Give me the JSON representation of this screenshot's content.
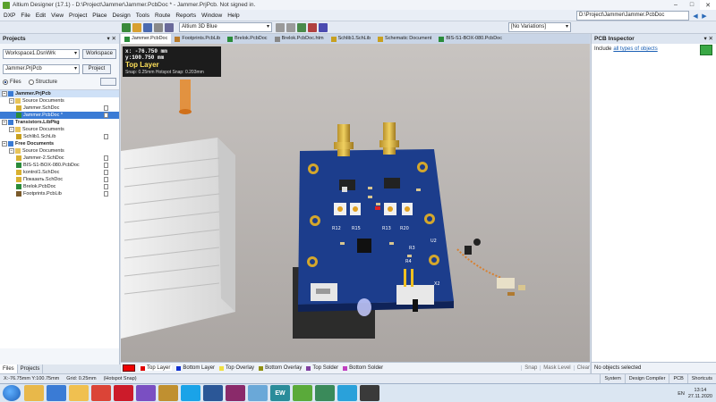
{
  "window": {
    "title": "Altium Designer (17.1) - D:\\Project\\Jammer\\Jammer.PcbDoc * - Jammer.PrjPcb. Not signed in.",
    "path": "D:\\Project\\Jammer\\Jammer.PcbDoc"
  },
  "menu": [
    "DXP",
    "File",
    "Edit",
    "View",
    "Project",
    "Place",
    "Design",
    "Tools",
    "Route",
    "Reports",
    "Window",
    "Help"
  ],
  "toolbar": {
    "view_mode": "Altium 3D Blue",
    "variations": "[No Variations]"
  },
  "projects_panel": {
    "title": "Projects",
    "workspace": "Workspace1.DsnWrk",
    "workspace_button": "Workspace",
    "project": "Jammer.PrjPcb",
    "project_button": "Project",
    "radio_files": "Files",
    "radio_structure": "Structure",
    "tree": [
      {
        "label": "Jammer.PrjPcb",
        "level": 0,
        "type": "project",
        "bold": true,
        "hl": true
      },
      {
        "label": "Source Documents",
        "level": 1,
        "type": "folder"
      },
      {
        "label": "Jammer.SchDoc",
        "level": 2,
        "type": "sch"
      },
      {
        "label": "Jammer.PcbDoc *",
        "level": 2,
        "type": "pcb",
        "selected": true
      },
      {
        "label": "Transistors.LibPkg",
        "level": 0,
        "type": "project",
        "bold": true
      },
      {
        "label": "Source Documents",
        "level": 1,
        "type": "folder"
      },
      {
        "label": "Schlib1.SchLib",
        "level": 2,
        "type": "schlib"
      },
      {
        "label": "Free Documents",
        "level": 0,
        "type": "project",
        "bold": true
      },
      {
        "label": "Source Documents",
        "level": 1,
        "type": "folder"
      },
      {
        "label": "Jammer-2.SchDoc",
        "level": 2,
        "type": "sch"
      },
      {
        "label": "BIS-S1-BOX-080.PcbDoc",
        "level": 2,
        "type": "pcb"
      },
      {
        "label": "kontrol1.SchDoc",
        "level": 2,
        "type": "sch"
      },
      {
        "label": "Показать.SchDoc",
        "level": 2,
        "type": "sch"
      },
      {
        "label": "Brelok.PcbDoc",
        "level": 2,
        "type": "pcb"
      },
      {
        "label": "Footprints.PcbLib",
        "level": 2,
        "type": "pcblib"
      }
    ],
    "footer_tabs": [
      "Files",
      "Projects"
    ]
  },
  "doc_tabs": [
    {
      "label": "Jammer.PcbDoc",
      "active": true,
      "color": "#2a8c3a"
    },
    {
      "label": "Footprints.PcbLib",
      "color": "#b87b2a"
    },
    {
      "label": "Brelok.PcbDoc",
      "color": "#2a8c3a"
    },
    {
      "label": "Brelok.PcbDoc.htm",
      "color": "#888888"
    },
    {
      "label": "Schlib1.SchLib",
      "color": "#c8a020"
    },
    {
      "label": "Schematic Document",
      "color": "#c8a020"
    },
    {
      "label": "BIS-S1-BOX-080.PcbDoc",
      "color": "#2a8c3a"
    }
  ],
  "hud": {
    "x": "x: -76.750 mm",
    "y": "y:100.750 mm",
    "layer": "Top Layer",
    "snap": "Snap: 0.25mm Hotspot Snap: 0.203mm"
  },
  "layers": [
    {
      "label": "Top Layer",
      "color": "#e00000",
      "active": true
    },
    {
      "label": "Bottom Layer",
      "color": "#1030d0"
    },
    {
      "label": "Top Overlay",
      "color": "#f0e040"
    },
    {
      "label": "Bottom Overlay",
      "color": "#909010"
    },
    {
      "label": "Top Solder",
      "color": "#8040a0"
    },
    {
      "label": "Bottom Solder",
      "color": "#c040c0"
    }
  ],
  "layer_bar_tools": [
    "Snap",
    "Mask Level",
    "Clear"
  ],
  "inspector": {
    "title": "PCB Inspector",
    "include_label": "Include",
    "include_link": "all types of objects",
    "selection": "No objects selected"
  },
  "status": {
    "coords": "X:-76.75mm Y:100.75mm",
    "grid": "Grid: 0.25mm",
    "snap": "(Hotspot Snap)",
    "right": [
      "System",
      "Design Compiler",
      "PCB",
      "Shortcuts"
    ]
  },
  "taskbar": {
    "apps": [
      {
        "name": "explorer",
        "color": "#e8b84a"
      },
      {
        "name": "media",
        "color": "#3a7bd5"
      },
      {
        "name": "folder",
        "color": "#f0c050"
      },
      {
        "name": "chrome",
        "color": "#db4437"
      },
      {
        "name": "opera",
        "color": "#cc1b2a"
      },
      {
        "name": "viber",
        "color": "#7a4fc2"
      },
      {
        "name": "game",
        "color": "#c09030"
      },
      {
        "name": "skype",
        "color": "#1aa3e8"
      },
      {
        "name": "word",
        "color": "#2b5797"
      },
      {
        "name": "winrar",
        "color": "#8a2a6a"
      },
      {
        "name": "notes",
        "color": "#6aa8d8"
      },
      {
        "name": "ew",
        "color": "#2a8c9a",
        "text": "EW"
      },
      {
        "name": "torrent",
        "color": "#5aaa3a"
      },
      {
        "name": "image",
        "color": "#3a8a5a"
      },
      {
        "name": "telegram",
        "color": "#2aa1da"
      },
      {
        "name": "altium",
        "color": "#3a3a3a"
      }
    ],
    "lang": "EN",
    "time": "13:14",
    "date": "27.11.2020"
  }
}
